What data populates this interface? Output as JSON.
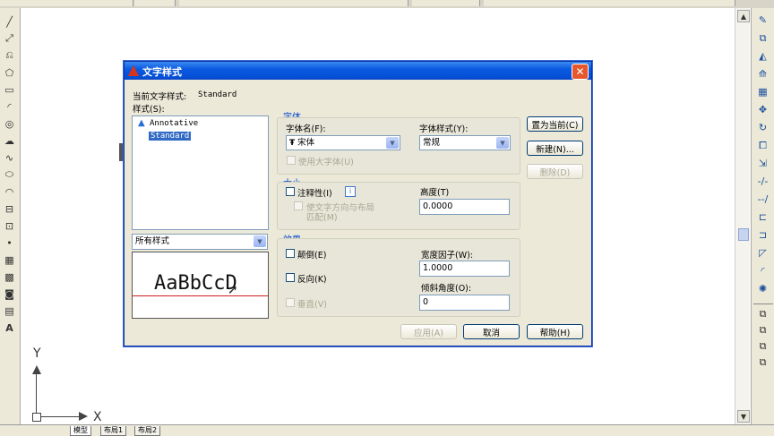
{
  "dialog": {
    "title": "文字样式",
    "current_style_label": "当前文字样式:",
    "current_style_value": "Standard",
    "styles_label": "样式(S):",
    "styles": [
      "Annotative",
      "Standard"
    ],
    "selected_style": "Standard",
    "filter_value": "所有样式",
    "preview_text": "AaBbCcD",
    "font_group": {
      "title": "字体",
      "font_name_label": "字体名(F):",
      "font_name_value": "宋体",
      "font_style_label": "字体样式(Y):",
      "font_style_value": "常规",
      "bigfont_label": "使用大字体(U)"
    },
    "size_group": {
      "title": "大小",
      "annotative_label": "注释性(I)",
      "match_label_line1": "使文字方向与布局",
      "match_label_line2": "匹配(M)",
      "height_label": "高度(T)",
      "height_value": "0.0000"
    },
    "effects_group": {
      "title": "效果",
      "upside_down_label": "颠倒(E)",
      "backwards_label": "反向(K)",
      "vertical_label": "垂直(V)",
      "width_factor_label": "宽度因子(W):",
      "width_factor_value": "1.0000",
      "oblique_label": "倾斜角度(O):",
      "oblique_value": "0"
    },
    "buttons": {
      "set_current": "置为当前(C)",
      "new": "新建(N)...",
      "delete": "删除(D)",
      "apply": "应用(A)",
      "cancel": "取消",
      "help": "帮助(H)"
    }
  },
  "ucs": {
    "y_label": "Y",
    "x_label": "X"
  },
  "bottom_tabs": [
    "模型",
    "布局1",
    "布局2"
  ]
}
